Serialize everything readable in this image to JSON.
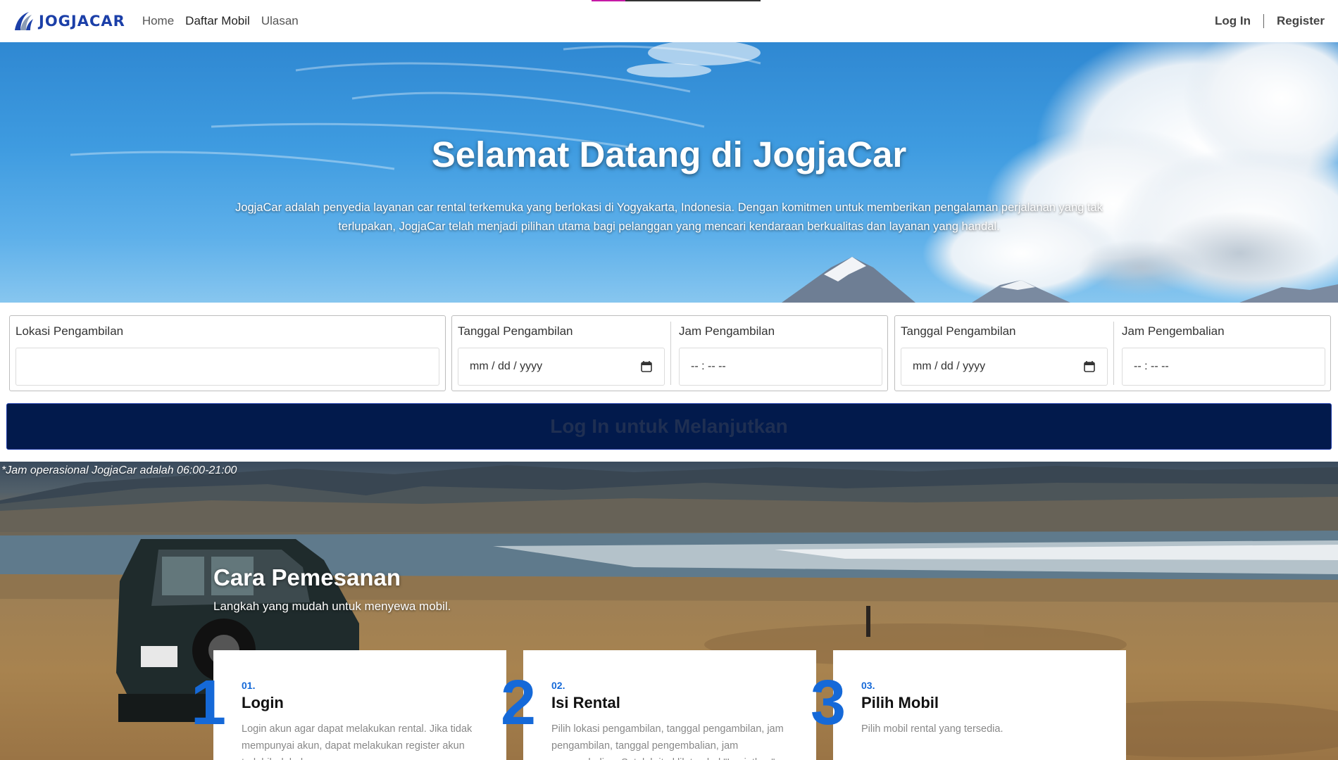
{
  "nav": {
    "brand": "JOGJACAR",
    "links": [
      "Home",
      "Daftar Mobil",
      "Ulasan"
    ],
    "login": "Log In",
    "register": "Register"
  },
  "hero": {
    "title": "Selamat Datang di JogjaCar",
    "description": "JogjaCar adalah penyedia layanan car rental terkemuka yang berlokasi di Yogyakarta, Indonesia. Dengan komitmen untuk memberikan pengalaman perjalanan yang tak terlupakan, JogjaCar telah menjadi pilihan utama bagi pelanggan yang mencari kendaraan berkualitas dan layanan yang handal."
  },
  "form": {
    "location_label": "Lokasi Pengambilan",
    "location_value": "",
    "pickup_date_label": "Tanggal Pengambilan",
    "pickup_date_value": "mm / dd / yyyy",
    "pickup_time_label": "Jam Pengambilan",
    "pickup_time_value": "-- : --   --",
    "return_date_label": "Tanggal Pengambilan",
    "return_date_value": "mm / dd / yyyy",
    "return_time_label": "Jam Pengembalian",
    "return_time_value": "-- : --   --",
    "submit": "Log In untuk Melanjutkan",
    "note": "*Jam operasional JogjaCar adalah 06:00-21:00"
  },
  "how_to": {
    "title": "Cara Pemesanan",
    "subtitle": "Langkah yang mudah untuk menyewa mobil.",
    "steps": [
      {
        "big": "1",
        "num": "01.",
        "title": "Login",
        "text": "Login akun agar dapat melakukan rental. Jika tidak mempunyai akun, dapat melakukan register akun terlebih dahulu."
      },
      {
        "big": "2",
        "num": "02.",
        "title": "Isi Rental",
        "text": "Pilih lokasi pengambilan, tanggal pengambilan, jam pengambilan, tanggal pengembalian, jam pengembalian. Setelah itu klik tombol \"Lanjutkan\"."
      },
      {
        "big": "3",
        "num": "03.",
        "title": "Pilih Mobil",
        "text": "Pilih mobil rental yang tersedia."
      }
    ]
  },
  "colors": {
    "brand": "#1b3fa8",
    "accent": "#1569d8",
    "button_bg": "#021a4c"
  }
}
